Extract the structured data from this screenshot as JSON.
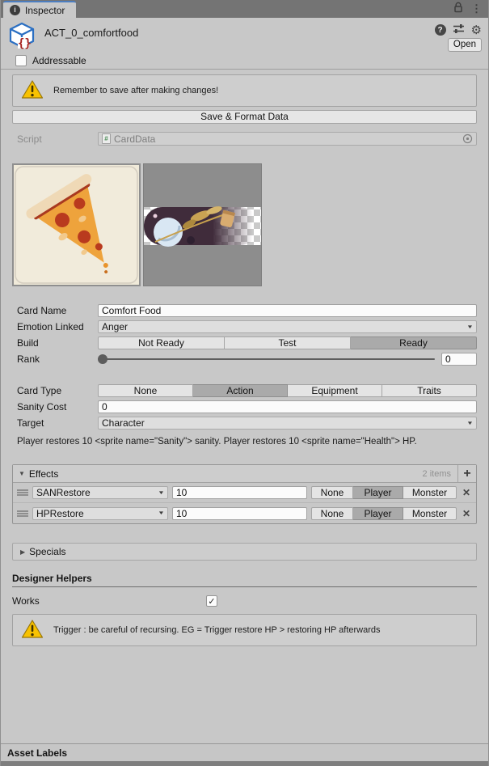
{
  "tab": {
    "title": "Inspector"
  },
  "header": {
    "title": "ACT_0_comfortfood",
    "open_label": "Open"
  },
  "addressable": {
    "label": "Addressable",
    "checked": false
  },
  "save_warning": {
    "text": "Remember to save after making changes!"
  },
  "save_button": {
    "label": "Save & Format Data"
  },
  "script_row": {
    "label": "Script",
    "value": "CardData"
  },
  "fields": {
    "card_name": {
      "label": "Card Name",
      "value": "Comfort Food"
    },
    "emotion_linked": {
      "label": "Emotion Linked",
      "value": "Anger"
    },
    "build": {
      "label": "Build",
      "options": [
        "Not Ready",
        "Test",
        "Ready"
      ],
      "selected": "Ready"
    },
    "rank": {
      "label": "Rank",
      "value": "0"
    },
    "card_type": {
      "label": "Card Type",
      "options": [
        "None",
        "Action",
        "Equipment",
        "Traits"
      ],
      "selected": "Action"
    },
    "sanity_cost": {
      "label": "Sanity Cost",
      "value": "0"
    },
    "target": {
      "label": "Target",
      "value": "Character"
    }
  },
  "description": "Player restores 10 <sprite name=\"Sanity\"> sanity. Player restores 10 <sprite name=\"Health\"> HP.",
  "effects": {
    "title": "Effects",
    "count_label": "2 items",
    "target_options": [
      "None",
      "Player",
      "Monster"
    ],
    "rows": [
      {
        "effect": "SANRestore",
        "value": "10",
        "target": "Player"
      },
      {
        "effect": "HPRestore",
        "value": "10",
        "target": "Player"
      }
    ]
  },
  "specials": {
    "title": "Specials"
  },
  "designer_helpers": {
    "title": "Designer Helpers",
    "works_label": "Works",
    "works_checked": true,
    "warning": "Trigger : be careful of recursing. EG = Trigger restore HP > restoring HP afterwards"
  },
  "footer": {
    "title": "Asset Labels"
  },
  "icons": {
    "info_glyph": "i",
    "kebab_glyph": "⋮",
    "help_glyph": "?",
    "gear_glyph": "⚙",
    "foldout_open_glyph": "▼",
    "foldout_closed_glyph": "▶",
    "dropdown_arrow_glyph": "▼",
    "add_glyph": "+",
    "remove_glyph": "✕",
    "check_glyph": "✓",
    "script_hash_glyph": "#"
  },
  "colors": {
    "tab_accent": "#4c7dbf",
    "background": "#c8c8c8",
    "warning_yellow": "#f8c200",
    "selected_segment": "#aaaaaa"
  }
}
